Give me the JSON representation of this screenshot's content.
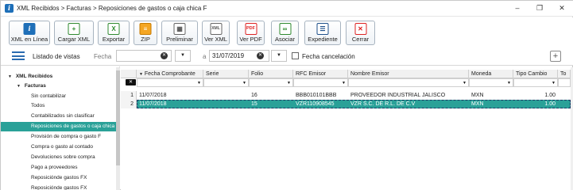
{
  "window": {
    "title": "XML Recibidos > Facturas > Reposiciones de gastos o caja chica F",
    "min_glyph": "–",
    "max_glyph": "❐",
    "close_glyph": "✕"
  },
  "toolbar": {
    "buttons": [
      {
        "label": "XML en Línea",
        "icon": "xml-online-icon",
        "glyph": "i"
      },
      {
        "label": "Cargar XML",
        "icon": "upload-xml-icon",
        "glyph": "+"
      },
      {
        "label": "Exportar",
        "icon": "excel-export-icon",
        "glyph": "X"
      },
      {
        "label": "ZIP",
        "icon": "zip-icon",
        "glyph": "≡"
      },
      {
        "label": "Preliminar",
        "icon": "preview-icon",
        "glyph": "▦"
      },
      {
        "label": "Ver XML",
        "icon": "xml-file-icon",
        "glyph": "XML"
      },
      {
        "label": "Ver PDF",
        "icon": "pdf-file-icon",
        "glyph": "PDF"
      },
      {
        "label": "Asociar",
        "icon": "link-icon",
        "glyph": "∞"
      },
      {
        "label": "Expediente",
        "icon": "document-icon",
        "glyph": "☰"
      },
      {
        "label": "Cerrar",
        "icon": "close-icon",
        "glyph": "✕"
      }
    ]
  },
  "filters": {
    "list_label": "Listado de vistas",
    "fecha_label": "Fecha",
    "date_from": "",
    "to_label": "a",
    "date_to": "31/07/2019",
    "clear_glyph": "✕",
    "dropdown_glyph": "▼",
    "cancel_label": "Fecha cancelación",
    "add_glyph": "+"
  },
  "sidebar": {
    "root": "XML Recibidos",
    "child": "Facturas",
    "items": [
      "Sin contabilizar",
      "Todos",
      "Contabilizados sin clasificar",
      "Reposiciones de gastos o caja chica F",
      "Provisión de compra o gasto F",
      "Compra o gasto al contado",
      "Devoluciones sobre compra",
      "Pago a proveedores",
      "Reposiciónde gastos FX",
      "Reposiciónde gastos FX"
    ],
    "selected_index": 3,
    "caret_glyph": "▼"
  },
  "grid": {
    "columns": [
      "Fecha Comprobante",
      "Serie",
      "Folio",
      "RFC Emisor",
      "Nombre Emisor",
      "Moneda",
      "Tipo Cambio",
      "To"
    ],
    "sort_glyph": "▼",
    "filter_glyph": "▼",
    "clear_filter_glyph": "✕",
    "rows": [
      {
        "num": "1",
        "fecha": "11/07/2018",
        "serie": "",
        "folio": "16",
        "rfc": "BBB010101BBB",
        "nombre": "PROVEEDOR INDUSTRIAL JALISCO",
        "moneda": "MXN",
        "tipo_cambio": "1.00"
      },
      {
        "num": "2",
        "fecha": "11/07/2018",
        "serie": "",
        "folio": "15",
        "rfc": "VZR110908545",
        "nombre": "VZR  S.C. DE R.L. DE C.V",
        "moneda": "MXN",
        "tipo_cambio": "1.00"
      }
    ],
    "selected_row": 1
  },
  "colors": {
    "selection": "#2aa198",
    "accent": "#1e6fb8"
  }
}
